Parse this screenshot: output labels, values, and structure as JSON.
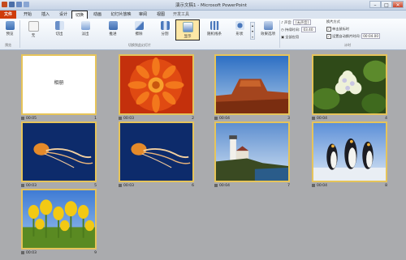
{
  "window": {
    "title": "演示文稿1 - Microsoft PowerPoint",
    "minimize": "–",
    "maximize": "□",
    "close": "✕"
  },
  "tabs": [
    {
      "label": "文件"
    },
    {
      "label": "开始"
    },
    {
      "label": "插入"
    },
    {
      "label": "设计"
    },
    {
      "label": "切换"
    },
    {
      "label": "动画"
    },
    {
      "label": "幻灯片放映"
    },
    {
      "label": "审阅"
    },
    {
      "label": "视图"
    },
    {
      "label": "开发工具"
    }
  ],
  "ribbon": {
    "preview": "预览",
    "effects": [
      {
        "label": "无"
      },
      {
        "label": "切出"
      },
      {
        "label": "淡出"
      },
      {
        "label": "推进"
      },
      {
        "label": "擦除"
      },
      {
        "label": "分割"
      },
      {
        "label": "显示"
      },
      {
        "label": "随机线条"
      },
      {
        "label": "形状"
      }
    ],
    "effect_options": "效果选项",
    "group_preview": "预览",
    "group_switch": "切换到此幻灯片",
    "group_timing": "计时",
    "sound_label": "声音:",
    "sound_value": "[无声音]",
    "duration_label": "持续时间:",
    "duration_value": "03.40",
    "apply_all": "全部应用",
    "advance_title": "换片方式",
    "on_click": "单击鼠标时",
    "after_label": "设置自动换片时间:",
    "after_value": "00:04.00"
  },
  "slides": [
    {
      "number": "1",
      "time": "00:05",
      "title": "相册",
      "kind": "title"
    },
    {
      "number": "2",
      "time": "00:03",
      "kind": "chrysanthemum"
    },
    {
      "number": "3",
      "time": "00:04",
      "kind": "desert"
    },
    {
      "number": "4",
      "time": "00:04",
      "kind": "hydrangeas"
    },
    {
      "number": "5",
      "time": "00:03",
      "kind": "jellyfish"
    },
    {
      "number": "6",
      "time": "00:03",
      "kind": "jellyfish"
    },
    {
      "number": "7",
      "time": "00:04",
      "kind": "lighthouse"
    },
    {
      "number": "8",
      "time": "00:04",
      "kind": "penguins"
    },
    {
      "number": "9",
      "time": "00:03",
      "kind": "tulips"
    }
  ],
  "colors": {
    "accent": "#cf3c0b",
    "selection": "#e6c45a",
    "ribbon_selected": "#fde7a6"
  }
}
